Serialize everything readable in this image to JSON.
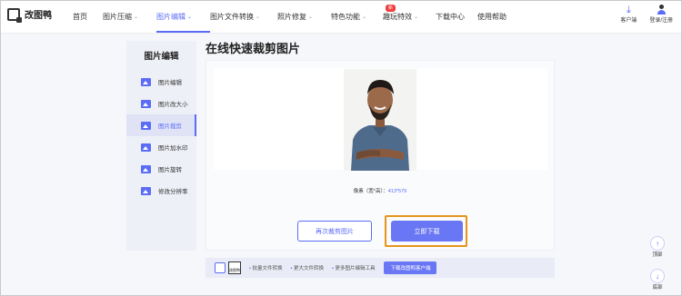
{
  "header": {
    "logo_text": "改图鸭",
    "nav": [
      {
        "label": "首页"
      },
      {
        "label": "图片压缩",
        "caret": "⌄"
      },
      {
        "label": "图片编辑",
        "caret": "⌄"
      },
      {
        "label": "图片文件转换",
        "caret": "⌄"
      },
      {
        "label": "照片修复",
        "caret": "⌄"
      },
      {
        "label": "特色功能",
        "caret": "⌄",
        "badge": "新"
      },
      {
        "label": "趣玩特效",
        "caret": "⌄"
      },
      {
        "label": "下载中心"
      },
      {
        "label": "使用帮助"
      }
    ],
    "client_label": "客户端",
    "login_label": "登录/注册"
  },
  "sidebar": {
    "title": "图片编辑",
    "items": [
      {
        "label": "图片编辑",
        "icon": "image-icon"
      },
      {
        "label": "图片改大小",
        "icon": "resize-icon"
      },
      {
        "label": "图片裁剪",
        "icon": "crop-icon",
        "active": true
      },
      {
        "label": "图片加水印",
        "icon": "watermark-icon"
      },
      {
        "label": "图片旋转",
        "icon": "rotate-icon"
      },
      {
        "label": "修改分辨率",
        "icon": "resolution-icon"
      }
    ]
  },
  "main": {
    "title": "在线快速裁剪图片",
    "pixel_label": "像素（宽*高）：",
    "pixel_value": "413*579",
    "recrop_label": "再次裁剪图片",
    "download_label": "立即下载"
  },
  "bottom_bar": {
    "promo_label": "改图鸭",
    "features": [
      "批量文件转换",
      "更大文件转换",
      "更多图片编辑工具"
    ],
    "cta": "下载改图鸭客户端"
  },
  "floating": {
    "top_label": "顶部",
    "bottom_label": "底部"
  },
  "colors": {
    "accent": "#5b6cf7",
    "highlight_border": "#e6941a",
    "badge": "#f23b3b"
  }
}
